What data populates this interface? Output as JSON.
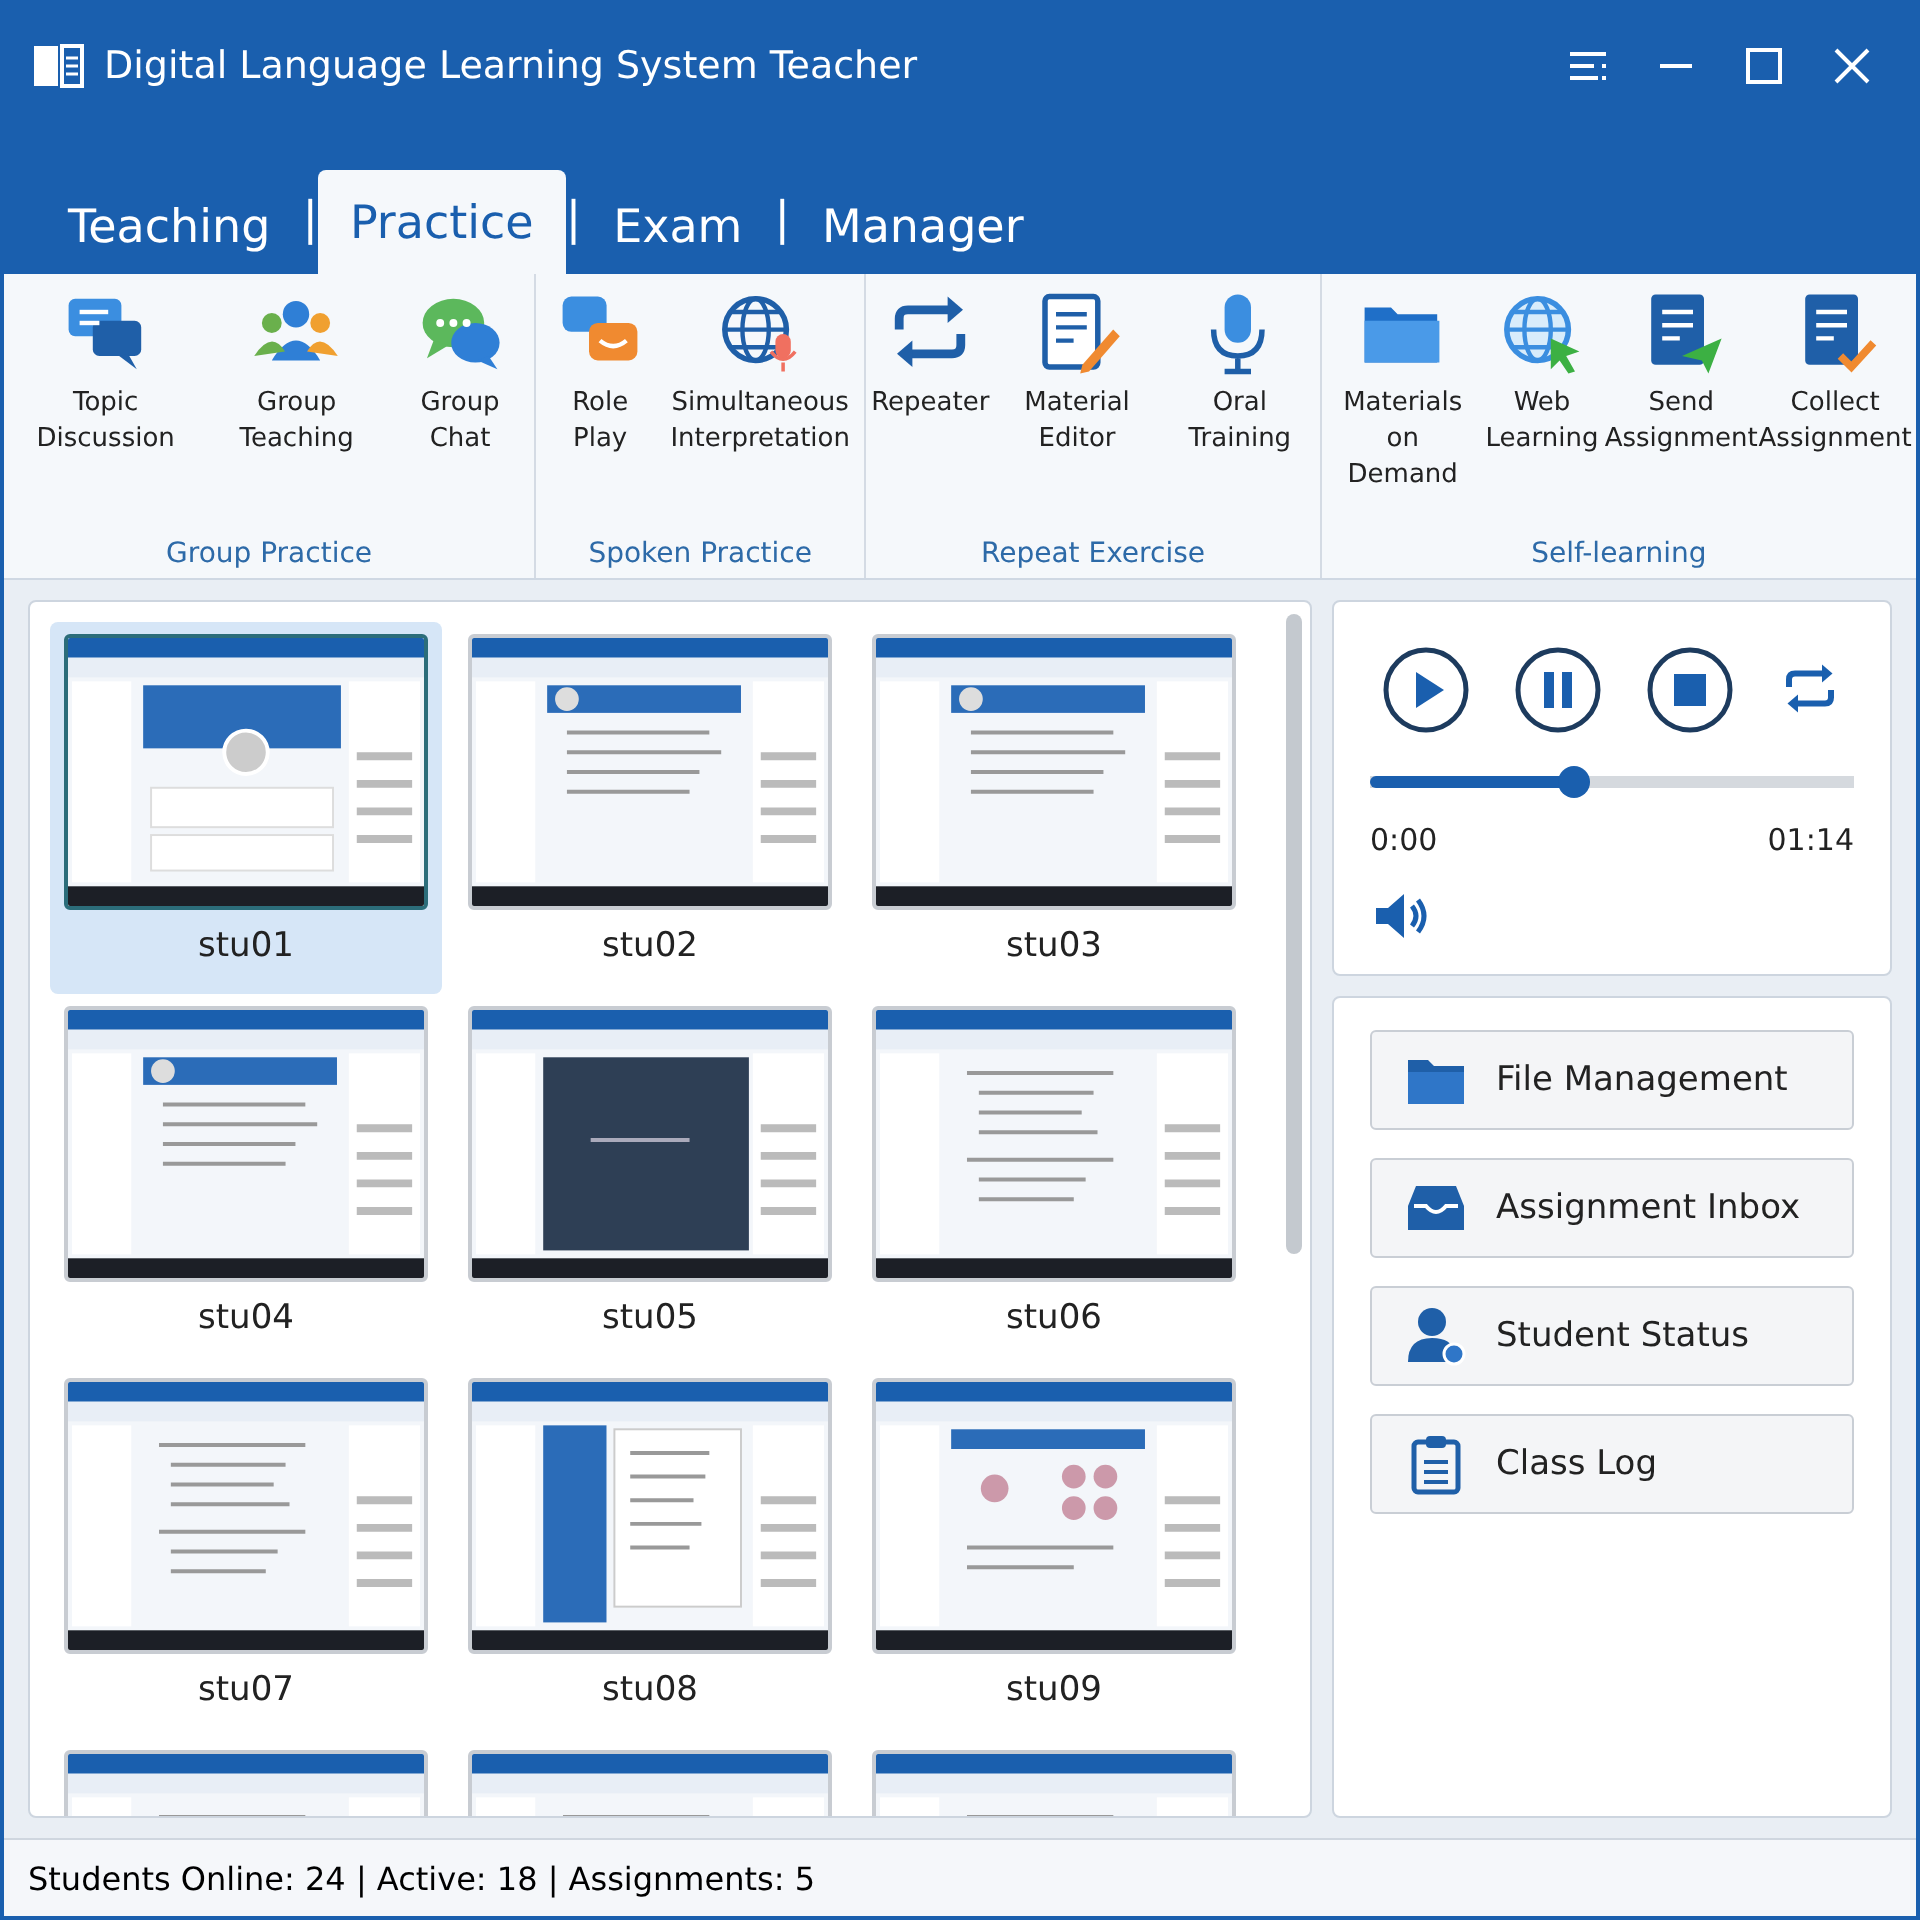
{
  "window": {
    "title": "Digital Language Learning System Teacher"
  },
  "tabs": [
    {
      "label": "Teaching",
      "selected": false
    },
    {
      "label": "Practice",
      "selected": true
    },
    {
      "label": "Exam",
      "selected": false
    },
    {
      "label": "Manager",
      "selected": false
    }
  ],
  "tab_separators": [
    "|",
    "|",
    "|"
  ],
  "ribbon_groups": [
    {
      "label": "Group Practice",
      "items": [
        {
          "label": "Topic Discussion"
        },
        {
          "label": "Group Teaching"
        },
        {
          "label": "Group Chat"
        }
      ]
    },
    {
      "label": "Spoken Practice",
      "items": [
        {
          "label": "Role Play"
        },
        {
          "label": "Simultaneous Interpretation"
        }
      ]
    },
    {
      "label": "Repeat Exercise",
      "items": [
        {
          "label": "Repeater"
        },
        {
          "label": "Material Editor"
        },
        {
          "label": "Oral Training"
        }
      ]
    },
    {
      "label": "Self-learning",
      "items": [
        {
          "label": "Materials on Demand"
        },
        {
          "label": "Web Learning"
        },
        {
          "label": "Send Assignment"
        },
        {
          "label": "Collect Assignment"
        }
      ]
    }
  ],
  "students": [
    {
      "name": "stu01",
      "selected": true,
      "kind": "profile"
    },
    {
      "name": "stu02",
      "selected": false,
      "kind": "quiz"
    },
    {
      "name": "stu03",
      "selected": false,
      "kind": "quiz"
    },
    {
      "name": "stu04",
      "selected": false,
      "kind": "quiz"
    },
    {
      "name": "stu05",
      "selected": false,
      "kind": "video"
    },
    {
      "name": "stu06",
      "selected": false,
      "kind": "list"
    },
    {
      "name": "stu07",
      "selected": false,
      "kind": "list"
    },
    {
      "name": "stu08",
      "selected": false,
      "kind": "folders"
    },
    {
      "name": "stu09",
      "selected": false,
      "kind": "photos"
    },
    {
      "selected": false,
      "kind": "list"
    },
    {
      "selected": false,
      "kind": "list"
    },
    {
      "selected": false,
      "kind": "list"
    }
  ],
  "player": {
    "level": 0.42,
    "current_time": "0:00",
    "total_time": "01:14"
  },
  "actions": [
    {
      "label": "File Management"
    },
    {
      "label": "Assignment Inbox"
    },
    {
      "label": "Student Status"
    },
    {
      "label": "Class Log"
    }
  ],
  "status_bar": {
    "text": "Students Online: 24 | Active: 18 | Assignments: 5"
  }
}
